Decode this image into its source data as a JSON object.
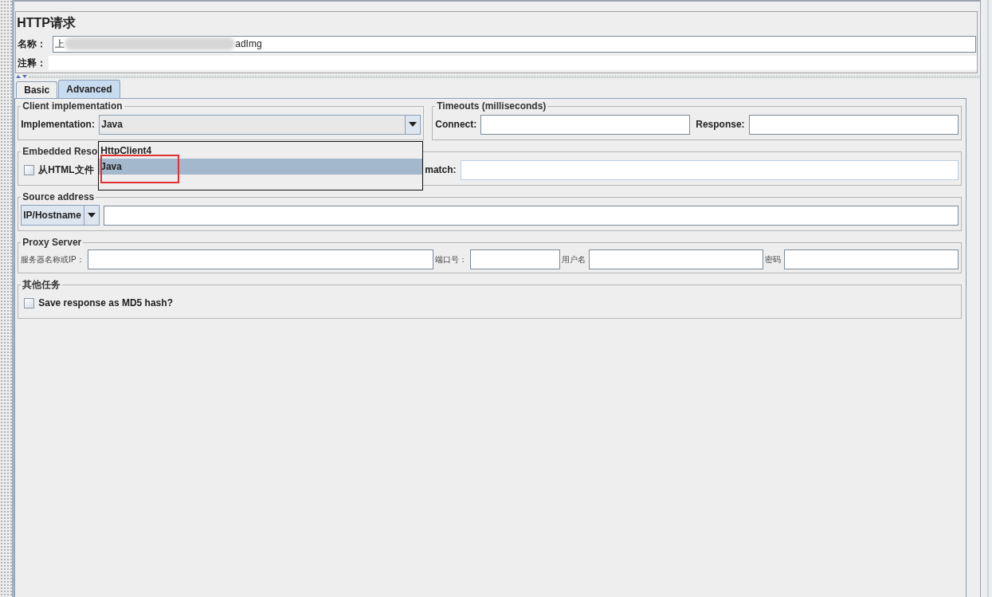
{
  "panel": {
    "title": "HTTP请求",
    "name_label": "名称：",
    "name_value_start": "上",
    "name_value_end": "adImg",
    "comment_label": "注释："
  },
  "tabs": [
    {
      "label": "Basic",
      "selected": false
    },
    {
      "label": "Advanced",
      "selected": true
    }
  ],
  "client_implementation": {
    "legend": "Client implementation",
    "label": "Implementation:",
    "value": "Java",
    "options": [
      {
        "label": "HttpClient4",
        "selected": false
      },
      {
        "label": "Java",
        "selected": true
      }
    ]
  },
  "timeouts": {
    "legend": "Timeouts (milliseconds)",
    "fields": [
      "Connect:",
      "Response:"
    ]
  },
  "embedded": {
    "legend": "Embedded Reso",
    "checkbox": {
      "label": "从HTML文件",
      "checked": false
    },
    "match_label": "match:"
  },
  "source_address": {
    "legend": "Source address",
    "type": "IP/Hostname"
  },
  "proxy": {
    "legend": "Proxy Server",
    "fields": [
      "服务器名称或IP：",
      "端口号：",
      "用户名",
      "密码"
    ]
  },
  "other": {
    "legend": "其他任务",
    "checkbox": {
      "label": "Save response as MD5 hash?",
      "checked": false
    }
  }
}
